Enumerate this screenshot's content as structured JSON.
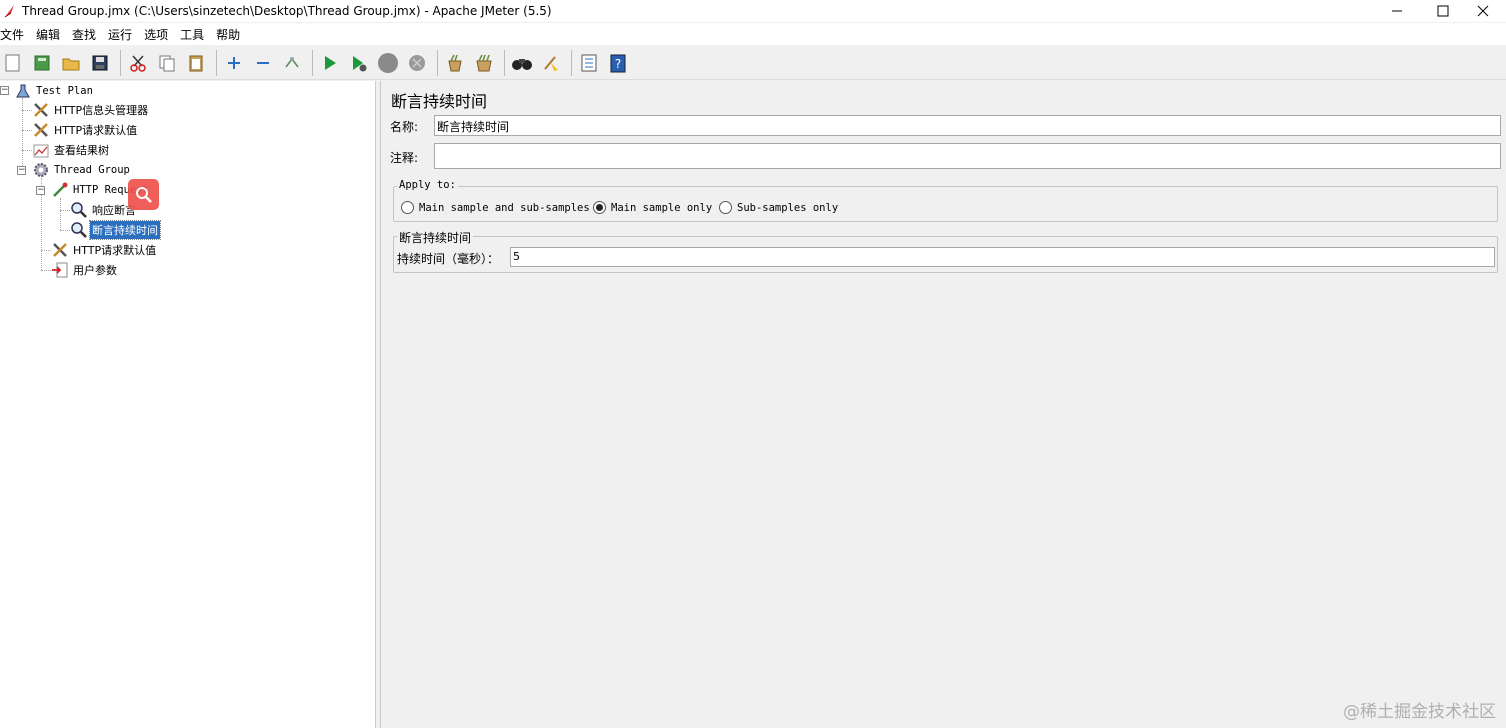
{
  "window": {
    "title": "Thread Group.jmx (C:\\Users\\sinzetech\\Desktop\\Thread Group.jmx) - Apache JMeter (5.5)"
  },
  "menu": [
    "文件",
    "编辑",
    "查找",
    "运行",
    "选项",
    "工具",
    "帮助"
  ],
  "toolbar": {
    "icons": [
      "new-icon",
      "templates-icon",
      "open-icon",
      "save-icon",
      "cut-icon",
      "copy-icon",
      "paste-icon",
      "expand-icon",
      "collapse-icon",
      "toggle-icon",
      "start-icon",
      "start-no-pauses-icon",
      "stop-icon",
      "shutdown-icon",
      "clear-icon",
      "clear-all-icon",
      "search-icon",
      "reset-search-icon",
      "function-helper-icon",
      "help-icon"
    ]
  },
  "tree": {
    "nodes": [
      {
        "label": "Test Plan",
        "icon": "test-plan-icon"
      },
      {
        "label": "HTTP信息头管理器",
        "icon": "tools-icon"
      },
      {
        "label": "HTTP请求默认值",
        "icon": "tools-icon"
      },
      {
        "label": "查看结果树",
        "icon": "chart-icon"
      },
      {
        "label": "Thread Group",
        "icon": "gear-icon"
      },
      {
        "label": "HTTP Request",
        "icon": "pipette-icon"
      },
      {
        "label": "响应断言",
        "icon": "magnifier-icon"
      },
      {
        "label": "断言持续时间",
        "icon": "magnifier-icon",
        "selected": true
      },
      {
        "label": "HTTP请求默认值",
        "icon": "tools-icon"
      },
      {
        "label": "用户参数",
        "icon": "preprocessor-icon"
      }
    ]
  },
  "panel": {
    "title": "断言持续时间",
    "name_label": "名称:",
    "name_value": "断言持续时间",
    "comment_label": "注释:",
    "comment_value": "",
    "apply_to": {
      "title": "Apply to:",
      "options": [
        "Main sample and sub-samples",
        "Main sample only",
        "Sub-samples only"
      ],
      "selected": "Main sample only"
    },
    "duration_group": {
      "title": "断言持续时间",
      "label": "持续时间（毫秒）：",
      "value": "5"
    }
  },
  "watermark": "@稀土掘金技术社区"
}
